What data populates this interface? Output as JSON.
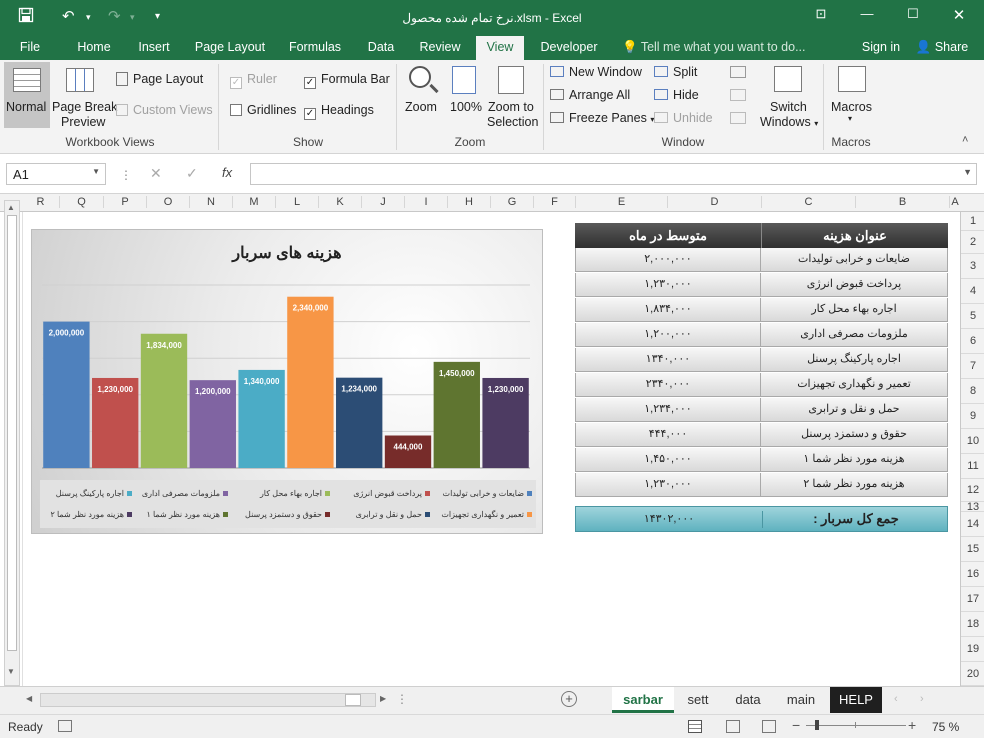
{
  "window": {
    "title": "نرخ تمام شده محصول.xlsm - Excel"
  },
  "ribbon_tabs": [
    "File",
    "Home",
    "Insert",
    "Page Layout",
    "Formulas",
    "Data",
    "Review",
    "View",
    "Developer"
  ],
  "tell_me": "Tell me what you want to do...",
  "account": {
    "sign_in": "Sign in",
    "share": "Share"
  },
  "groups": {
    "workbook_views": {
      "label": "Workbook Views",
      "normal": "Normal",
      "page_break": "Page Break",
      "page_break2": "Preview",
      "page_layout": "Page Layout",
      "custom_views": "Custom Views"
    },
    "show": {
      "label": "Show",
      "ruler": "Ruler",
      "formula_bar": "Formula Bar",
      "gridlines": "Gridlines",
      "headings": "Headings"
    },
    "zoom": {
      "label": "Zoom",
      "zoom": "Zoom",
      "z100": "100%",
      "zoom_sel": "Zoom to",
      "zoom_sel2": "Selection"
    },
    "window": {
      "label": "Window",
      "new_window": "New Window",
      "arrange_all": "Arrange All",
      "freeze_panes": "Freeze Panes",
      "split": "Split",
      "hide": "Hide",
      "unhide": "Unhide",
      "switch": "Switch",
      "switch2": "Windows"
    },
    "macros": {
      "label": "Macros",
      "macros": "Macros"
    }
  },
  "formula_bar": {
    "name_box": "A1",
    "fx": "fx",
    "formula": ""
  },
  "columns": [
    "R",
    "Q",
    "P",
    "O",
    "N",
    "M",
    "L",
    "K",
    "J",
    "I",
    "H",
    "G",
    "F",
    "E",
    "D",
    "C",
    "B",
    "A"
  ],
  "rows": [
    "1",
    "2",
    "3",
    "4",
    "5",
    "6",
    "7",
    "8",
    "9",
    "10",
    "11",
    "12",
    "13",
    "14",
    "15",
    "16",
    "17",
    "18",
    "19",
    "20"
  ],
  "table": {
    "header_title": "عنوان هزینه",
    "header_avg": "متوسط در ماه",
    "rows": [
      {
        "title": "ضایعات و خرابی تولیدات",
        "avg": "۲,۰۰۰,۰۰۰"
      },
      {
        "title": "پرداخت قبوض انرژی",
        "avg": "۱,۲۳۰,۰۰۰"
      },
      {
        "title": "اجاره بهاء محل کار",
        "avg": "۱,۸۳۴,۰۰۰"
      },
      {
        "title": "ملزومات مصرفی اداری",
        "avg": "۱,۲۰۰,۰۰۰"
      },
      {
        "title": "اجاره پارکینگ پرسنل",
        "avg": "۱۳۴۰,۰۰۰"
      },
      {
        "title": "تعمیر و نگهداری تجهیزات",
        "avg": "۲۳۴۰,۰۰۰"
      },
      {
        "title": "حمل و نقل و ترابری",
        "avg": "۱,۲۳۴,۰۰۰"
      },
      {
        "title": "حقوق و دستمزد پرسنل",
        "avg": "۴۴۴,۰۰۰"
      },
      {
        "title": "هزینه مورد نظر شما ۱",
        "avg": "۱,۴۵۰,۰۰۰"
      },
      {
        "title": "هزینه مورد نظر شما ۲",
        "avg": "۱,۲۳۰,۰۰۰"
      }
    ],
    "total_label": "جمع کل سربار :",
    "total_value": "۱۴۳۰۲,۰۰۰"
  },
  "chart_data": {
    "type": "bar",
    "title": "هزینه های سربار",
    "categories": [
      "ضایعات و خرابی تولیدات",
      "پرداخت قبوض انرژی",
      "اجاره بهاء محل کار",
      "ملزومات مصرفی اداری",
      "اجاره پارکینگ پرسنل",
      "تعمیر و نگهداری تجهیزات",
      "حمل و نقل و ترابری",
      "حقوق و دستمزد پرسنل",
      "هزینه مورد نظر شما ۱",
      "هزینه مورد نظر شما ۲"
    ],
    "values": [
      2000000,
      1230000,
      1834000,
      1200000,
      1340000,
      2340000,
      1234000,
      444000,
      1450000,
      1230000
    ],
    "labels": [
      "2,000,000",
      "1,230,000",
      "1,834,000",
      "1,200,000",
      "1,340,000",
      "2,340,000",
      "1,234,000",
      "444,000",
      "1,450,000",
      "1,230,000"
    ],
    "colors": [
      "#4f81bd",
      "#c0504d",
      "#9bbb59",
      "#8064a2",
      "#4bacc6",
      "#f79646",
      "#2c4d75",
      "#772c2a",
      "#5f7530",
      "#4d3b62"
    ],
    "ylim": [
      0,
      2500000
    ],
    "legend": "bottom",
    "grid": true
  },
  "sheets": [
    "sarbar",
    "sett",
    "data",
    "main",
    "HELP"
  ],
  "status": {
    "ready": "Ready",
    "zoom": "75 %"
  }
}
